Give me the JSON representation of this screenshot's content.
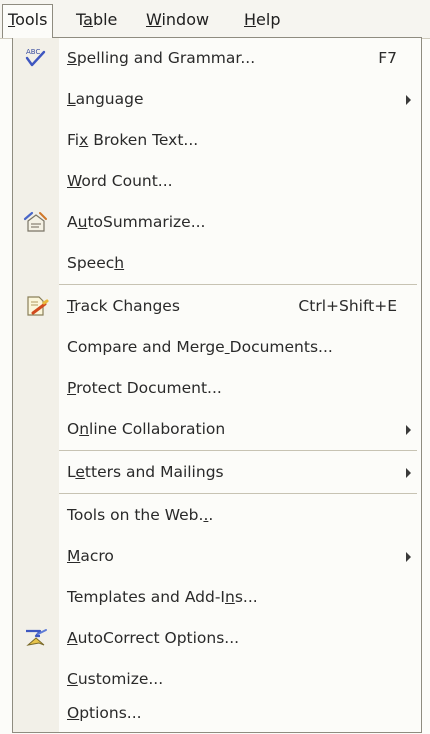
{
  "menubar": {
    "items": [
      {
        "label": "Tools",
        "mnemonic_index": 0
      },
      {
        "label": "Table",
        "mnemonic_index": 1
      },
      {
        "label": "Window",
        "mnemonic_index": 0
      },
      {
        "label": "Help",
        "mnemonic_index": 0
      }
    ]
  },
  "menu": {
    "items": [
      {
        "label": "Spelling and Grammar...",
        "mnemonic_index": 0,
        "shortcut": "F7",
        "icon": "spelling-check-icon"
      },
      {
        "label": "Language",
        "mnemonic_index": 0,
        "submenu": true
      },
      {
        "label": "Fix Broken Text...",
        "mnemonic_index": 2
      },
      {
        "label": "Word Count...",
        "mnemonic_index": 0
      },
      {
        "label": "AutoSummarize...",
        "mnemonic_index": 1,
        "icon": "autosummarize-icon"
      },
      {
        "label": "Speech",
        "mnemonic_index": 5
      },
      {
        "label": "Track Changes",
        "mnemonic_index": 0,
        "shortcut": "Ctrl+Shift+E",
        "icon": "track-changes-icon"
      },
      {
        "label": "Compare and Merge Documents...",
        "mnemonic_index": 17
      },
      {
        "label": "Protect Document...",
        "mnemonic_index": 0
      },
      {
        "label": "Online Collaboration",
        "mnemonic_index": 1,
        "submenu": true
      },
      {
        "label": "Letters and Mailings",
        "mnemonic_index": 1,
        "submenu": true
      },
      {
        "label": "Tools on the Web...",
        "mnemonic_index": 17
      },
      {
        "label": "Macro",
        "mnemonic_index": 0,
        "submenu": true
      },
      {
        "label": "Templates and Add-Ins...",
        "mnemonic_index": 19
      },
      {
        "label": "AutoCorrect Options...",
        "mnemonic_index": 0,
        "icon": "autocorrect-icon"
      },
      {
        "label": "Customize...",
        "mnemonic_index": 0
      },
      {
        "label": "Options...",
        "mnemonic_index": 0
      }
    ]
  },
  "colors": {
    "menu_background": "#fcfcf9",
    "gutter": "#f2f0e8",
    "border": "#8f8c80",
    "separator": "#c7c3b3",
    "text": "#2a2a2a"
  }
}
